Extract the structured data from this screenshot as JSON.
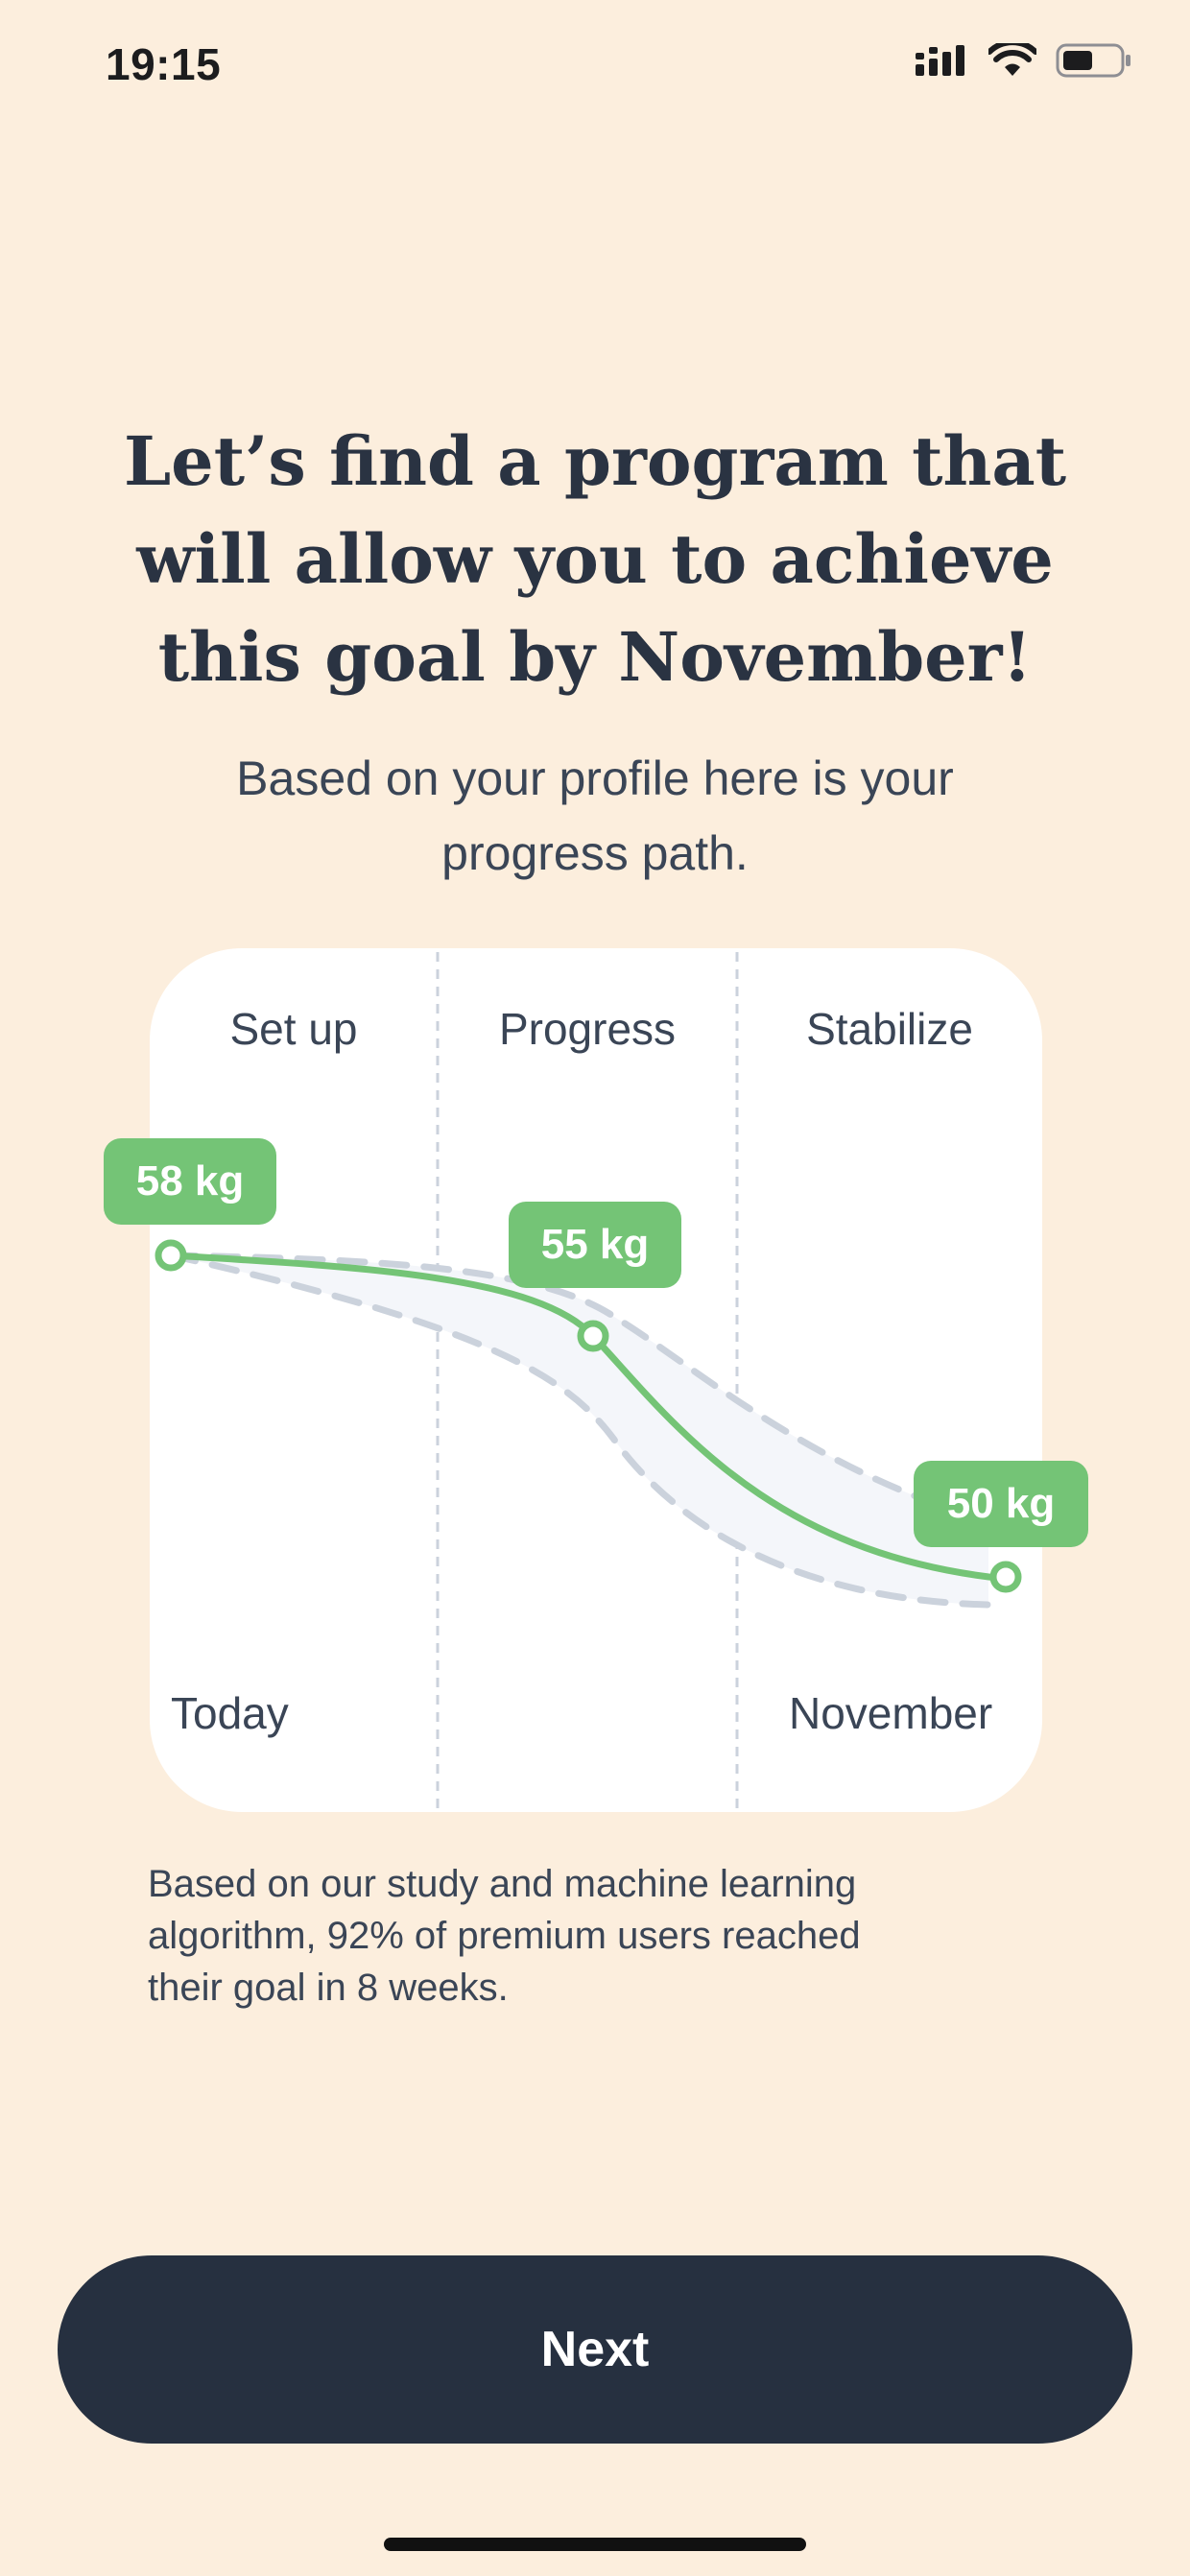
{
  "status_bar": {
    "time": "19:15",
    "icons": [
      "signal-icon",
      "wifi-icon",
      "battery-icon"
    ]
  },
  "headline": {
    "line1": "Let’s find a program that",
    "line2": "will allow you to achieve",
    "line3": "this goal by November!"
  },
  "subtitle": {
    "line1": "Based on your profile here is your",
    "line2": "progress path."
  },
  "chart_data": {
    "type": "line",
    "phases": [
      "Set up",
      "Progress",
      "Stabilize"
    ],
    "x_labels": [
      "Today",
      "November"
    ],
    "series": [
      {
        "points": [
          {
            "label": "58 kg",
            "value": 58
          },
          {
            "label": "55 kg",
            "value": 55
          },
          {
            "label": "50 kg",
            "value": 50
          }
        ]
      }
    ],
    "colors": {
      "line": "#74C476",
      "band": "#C9CFD9",
      "badge": "#74C476"
    }
  },
  "footnote": {
    "line1": "Based on our study and machine learning",
    "line2": "algorithm, 92% of premium users reached",
    "line3": "their goal in 8 weeks."
  },
  "actions": {
    "next_label": "Next"
  },
  "colors": {
    "background": "#FCEEDD",
    "button": "#263040",
    "accent": "#74C476"
  }
}
